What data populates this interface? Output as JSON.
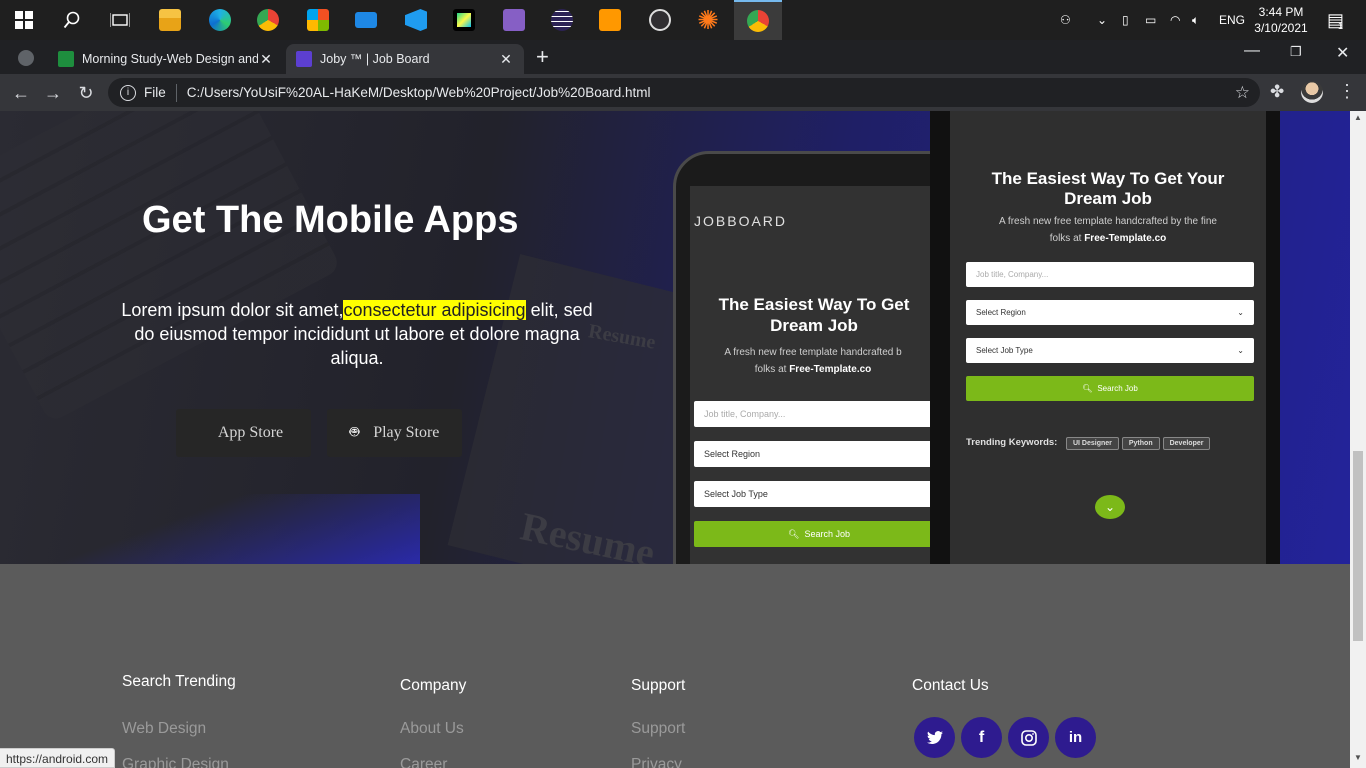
{
  "taskbar": {
    "apps": [
      "windows-start",
      "search",
      "task-view",
      "file-explorer",
      "edge",
      "chrome",
      "store",
      "mail",
      "vscode",
      "pycharm",
      "visual-studio",
      "eclipse",
      "sublime-text",
      "obs",
      "claude",
      "chrome-active"
    ],
    "language": "ENG",
    "time": "3:44 PM",
    "date": "3/10/2021",
    "notification_count": "1"
  },
  "browser": {
    "tabs": [
      {
        "title": "Morning Study-Web Design and",
        "active": false
      },
      {
        "title": "Joby ™ | Job Board",
        "active": true
      }
    ],
    "new_tab": "+",
    "scheme_label": "File",
    "url": "C:/Users/YoUsiF%20AL-HaKeM/Desktop/Web%20Project/Job%20Board.html"
  },
  "hero": {
    "title": "Get The Mobile Apps",
    "text_before": "Lorem ipsum dolor sit amet,",
    "text_highlight": "consectetur adipisicing",
    "text_after": " elit, sed do eiusmod tempor incididunt ut labore et dolore magna aliqua.",
    "app_store": "App Store",
    "play_store": "Play Store",
    "bg_word": "Resume"
  },
  "phone_left": {
    "brand": "JOBBOARD",
    "title": "The Easiest Way To Get Dream Job",
    "subtitle_a": "A fresh new free template handcrafted b",
    "subtitle_b": "folks at ",
    "subtitle_link": "Free-Template.co",
    "input_placeholder": "Job title, Company...",
    "region": "Select Region",
    "job_type": "Select Job Type",
    "search": "Search Job"
  },
  "phone_right": {
    "title": "The Easiest Way To Get Your Dream Job",
    "subtitle_a": "A fresh new free template handcrafted by the fine",
    "subtitle_b": "folks at ",
    "subtitle_link": "Free-Template.co",
    "input_placeholder": "Job title, Company...",
    "region": "Select Region",
    "job_type": "Select Job Type",
    "search": "Search Job",
    "trending_label": "Trending Keywords:",
    "keywords": [
      "UI Designer",
      "Python",
      "Developer"
    ]
  },
  "footer": {
    "col1": {
      "heading": "Search Trending",
      "links": [
        "Web Design",
        "Graphic Design"
      ]
    },
    "col2": {
      "heading": "Company",
      "links": [
        "About Us",
        "Career"
      ]
    },
    "col3": {
      "heading": "Support",
      "links": [
        "Support",
        "Privacy"
      ]
    },
    "col4": {
      "heading": "Contact Us",
      "social": [
        "twitter",
        "facebook",
        "instagram",
        "linkedin"
      ]
    }
  },
  "status_url": "https://android.com",
  "colors": {
    "accent_green": "#7cb919",
    "social_purple": "#2e1b8f",
    "highlight": "#ffff00"
  }
}
